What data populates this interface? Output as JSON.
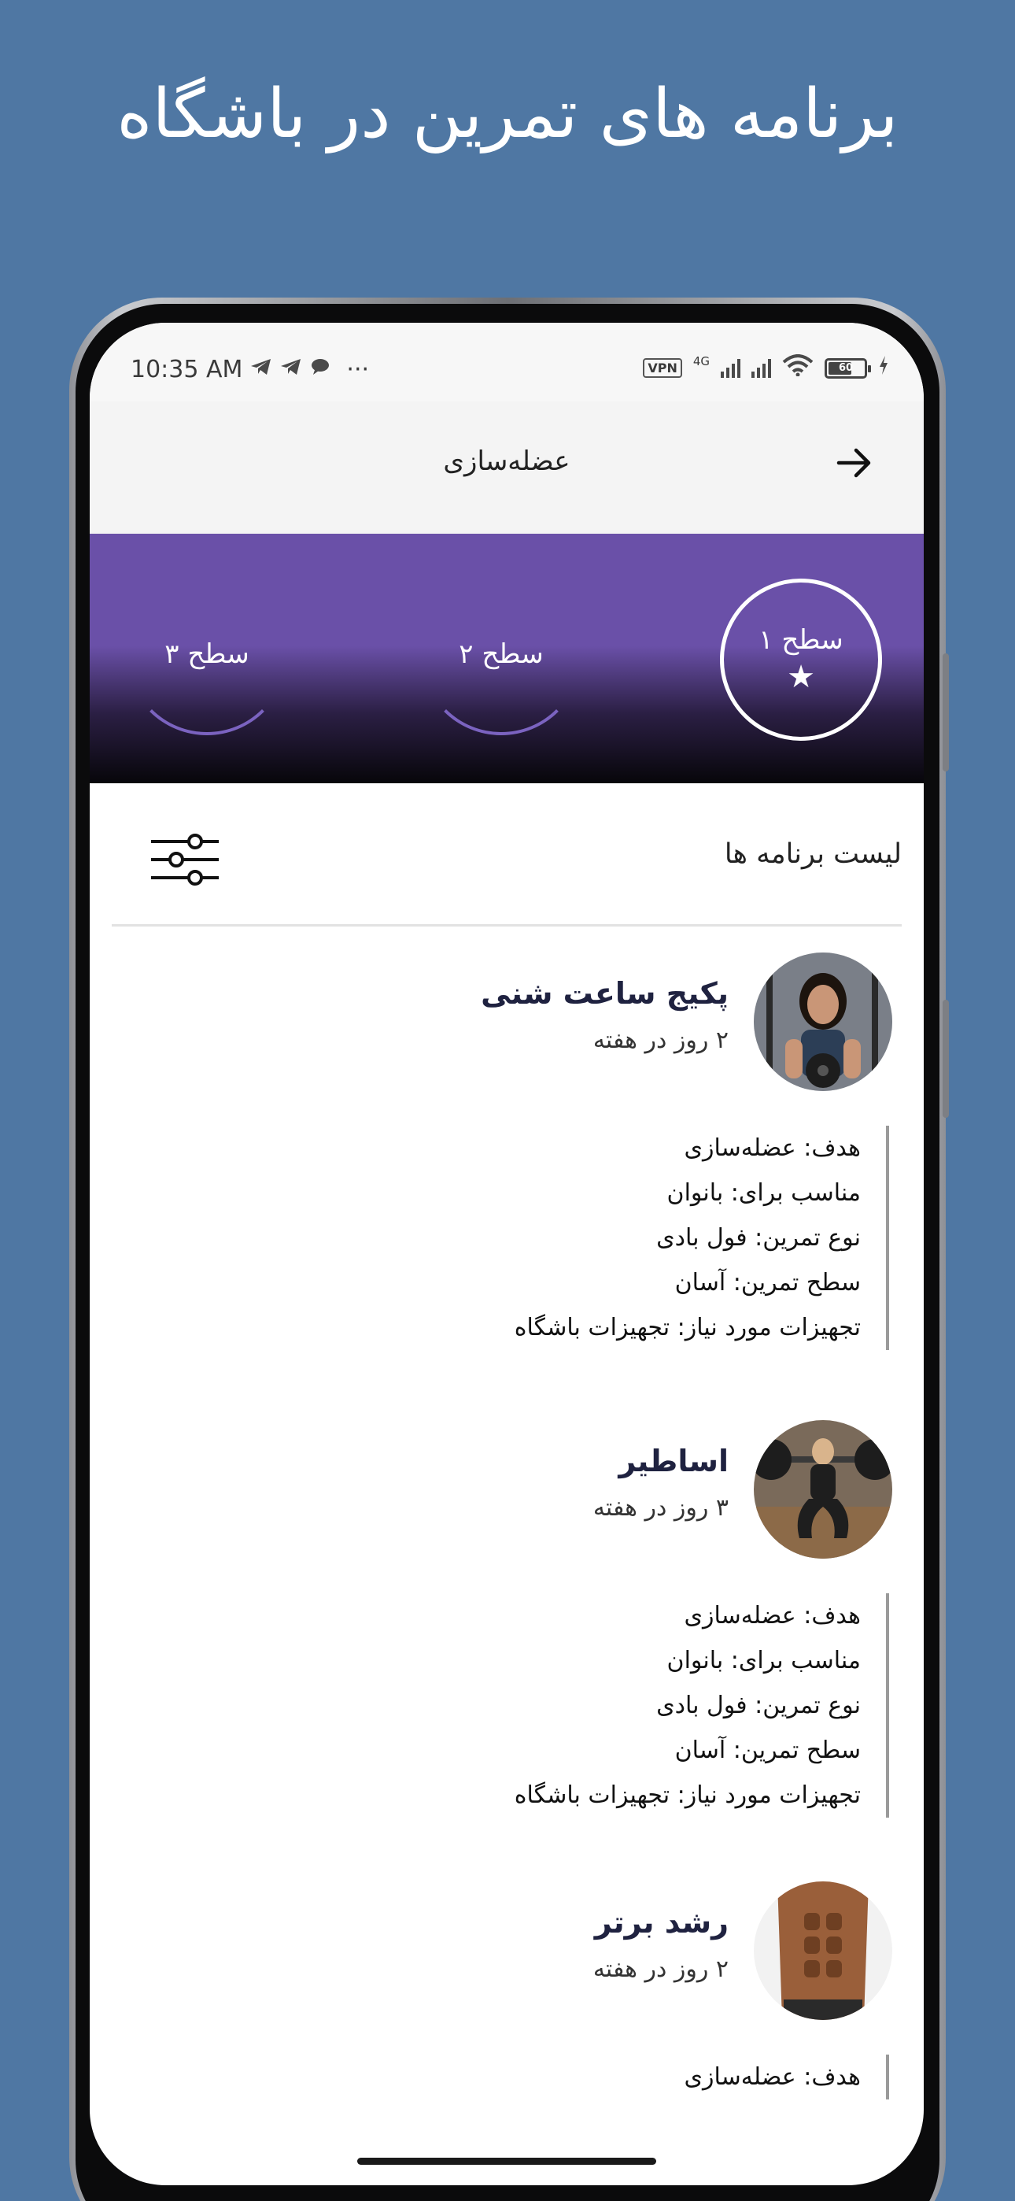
{
  "headline": "برنامه های تمرین در باشگاه",
  "status_bar": {
    "time": "10:35 AM",
    "dots": "···",
    "vpn": "VPN",
    "network": "4G",
    "battery": "60"
  },
  "app_bar": {
    "title": "عضله‌سازی"
  },
  "levels": [
    {
      "label": "سطح ۱",
      "active": true
    },
    {
      "label": "سطح ۲",
      "active": false
    },
    {
      "label": "سطح ۳",
      "active": false
    }
  ],
  "list": {
    "title": "لیست برنامه ها"
  },
  "programs": [
    {
      "name": "پکیج ساعت شنی",
      "days": "۲ روز در هفته",
      "details": [
        "هدف: عضله‌سازی",
        "مناسب برای: بانوان",
        "نوع تمرین: فول بادی",
        "سطح تمرین: آسان",
        "تجهیزات مورد نیاز: تجهیزات باشگاه"
      ]
    },
    {
      "name": "اساطیر",
      "days": "۳ روز در هفته",
      "details": [
        "هدف: عضله‌سازی",
        "مناسب برای: بانوان",
        "نوع تمرین: فول بادی",
        "سطح تمرین: آسان",
        "تجهیزات مورد نیاز: تجهیزات باشگاه"
      ]
    },
    {
      "name": "رشد برتر",
      "days": "۲ روز در هفته",
      "details": [
        "هدف: عضله‌سازی"
      ]
    }
  ],
  "colors": {
    "background": "#4f77a3",
    "banner_purple": "#6a50a8",
    "title_navy": "#1f2240"
  }
}
